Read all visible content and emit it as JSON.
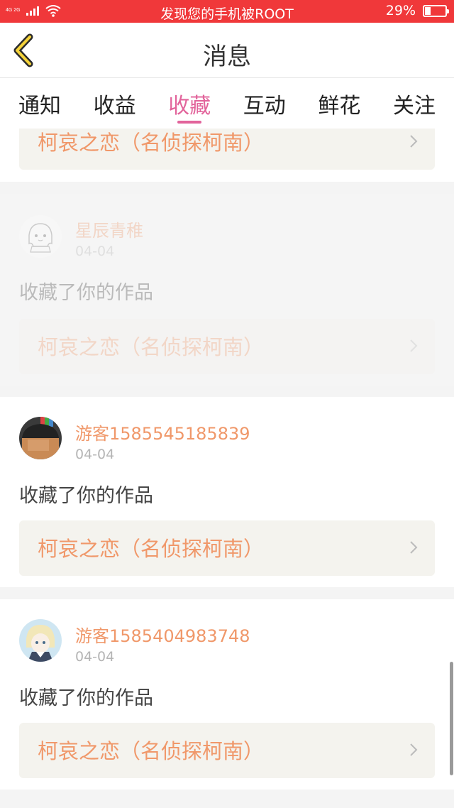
{
  "status_bar": {
    "network": "4G 2G",
    "notice": "发现您的手机被ROOT",
    "battery_text": "29%",
    "battery_level": 0.29,
    "bg_color": "#f0383a"
  },
  "header": {
    "back_icon": "chevron-left-icon",
    "title": "消息"
  },
  "tabs": [
    {
      "label": "通知"
    },
    {
      "label": "收益"
    },
    {
      "label": "收藏",
      "active": true
    },
    {
      "label": "互动"
    },
    {
      "label": "鲜花"
    },
    {
      "label": "关注"
    }
  ],
  "accent_color": "#e2649b",
  "name_color": "#f0986a",
  "messages": [
    {
      "user": "",
      "date": "",
      "action": "",
      "work_title": "柯哀之恋（名侦探柯南）"
    },
    {
      "user": "星辰青稚",
      "date": "04-04",
      "action": "收藏了你的作品",
      "work_title": "柯哀之恋（名侦探柯南）",
      "avatar": "anime-girl-sketch"
    },
    {
      "user": "游客1585545185839",
      "date": "04-04",
      "action": "收藏了你的作品",
      "work_title": "柯哀之恋（名侦探柯南）",
      "avatar": "cartoon-boy"
    },
    {
      "user": "游客1585404983748",
      "date": "04-04",
      "action": "收藏了你的作品",
      "work_title": "柯哀之恋（名侦探柯南）",
      "avatar": "anime-character"
    }
  ]
}
